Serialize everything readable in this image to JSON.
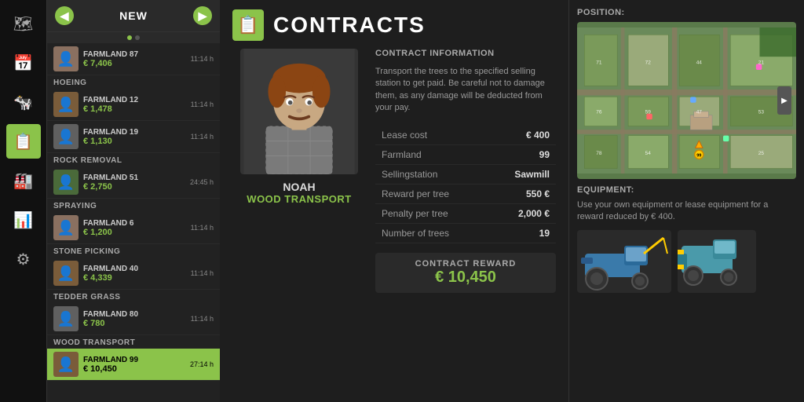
{
  "leftNav": {
    "icons": [
      {
        "id": "map-icon",
        "symbol": "🗺",
        "active": false
      },
      {
        "id": "calendar-icon",
        "symbol": "📅",
        "active": false
      },
      {
        "id": "animal-icon",
        "symbol": "🐄",
        "active": false
      },
      {
        "id": "contracts-icon-nav",
        "symbol": "📋",
        "active": true
      },
      {
        "id": "factory-icon",
        "symbol": "🏭",
        "active": false
      },
      {
        "id": "stats-icon",
        "symbol": "📊",
        "active": false
      },
      {
        "id": "settings-icon",
        "symbol": "⚙",
        "active": false
      }
    ]
  },
  "listHeader": {
    "title": "NEW",
    "prevBtn": "◀",
    "nextBtn": "▶"
  },
  "categories": [
    {
      "label": "",
      "items": [
        {
          "name": "FARMLAND 87",
          "price": "€ 7,406",
          "time": "11:14 h",
          "avatarColor": "tan",
          "selected": false
        }
      ]
    },
    {
      "label": "HOEING",
      "items": [
        {
          "name": "FARMLAND 12",
          "price": "€ 1,478",
          "time": "11:14 h",
          "avatarColor": "brown",
          "selected": false
        },
        {
          "name": "FARMLAND 19",
          "price": "€ 1,130",
          "time": "11:14 h",
          "avatarColor": "gray",
          "selected": false
        }
      ]
    },
    {
      "label": "ROCK REMOVAL",
      "items": [
        {
          "name": "FARMLAND 51",
          "price": "€ 2,750",
          "time": "24:45 h",
          "avatarColor": "green",
          "selected": false
        }
      ]
    },
    {
      "label": "SPRAYING",
      "items": [
        {
          "name": "FARMLAND 6",
          "price": "€ 1,200",
          "time": "11:14 h",
          "avatarColor": "tan",
          "selected": false
        }
      ]
    },
    {
      "label": "STONE PICKING",
      "items": [
        {
          "name": "FARMLAND 40",
          "price": "€ 4,339",
          "time": "11:14 h",
          "avatarColor": "brown",
          "selected": false
        }
      ]
    },
    {
      "label": "TEDDER GRASS",
      "items": [
        {
          "name": "FARMLAND 80",
          "price": "€ 780",
          "time": "11:14 h",
          "avatarColor": "gray",
          "selected": false
        }
      ]
    },
    {
      "label": "WOOD TRANSPORT",
      "items": [
        {
          "name": "FARMLAND 99",
          "price": "€ 10,450",
          "time": "27:14 h",
          "avatarColor": "brown",
          "selected": true
        }
      ]
    }
  ],
  "header": {
    "title": "CONTRACTS"
  },
  "character": {
    "name": "NOAH",
    "job": "WOOD TRANSPORT"
  },
  "contractInfo": {
    "sectionTitle": "CONTRACT INFORMATION",
    "description": "Transport the trees to the specified selling station to get paid. Be careful not to damage them, as any damage will be deducted from your pay.",
    "rows": [
      {
        "label": "Lease cost",
        "value": "€ 400"
      },
      {
        "label": "Farmland",
        "value": "99"
      },
      {
        "label": "Sellingstation",
        "value": "Sawmill"
      },
      {
        "label": "Reward per tree",
        "value": "550 €"
      },
      {
        "label": "Penalty per tree",
        "value": "2,000 €"
      },
      {
        "label": "Number of trees",
        "value": "19"
      }
    ],
    "rewardLabel": "CONTRACT REWARD",
    "rewardAmount": "€ 10,450"
  },
  "position": {
    "label": "POSITION:"
  },
  "equipment": {
    "label": "EQUIPMENT:",
    "description": "Use your own equipment or lease equipment for a reward reduced by € 400."
  }
}
